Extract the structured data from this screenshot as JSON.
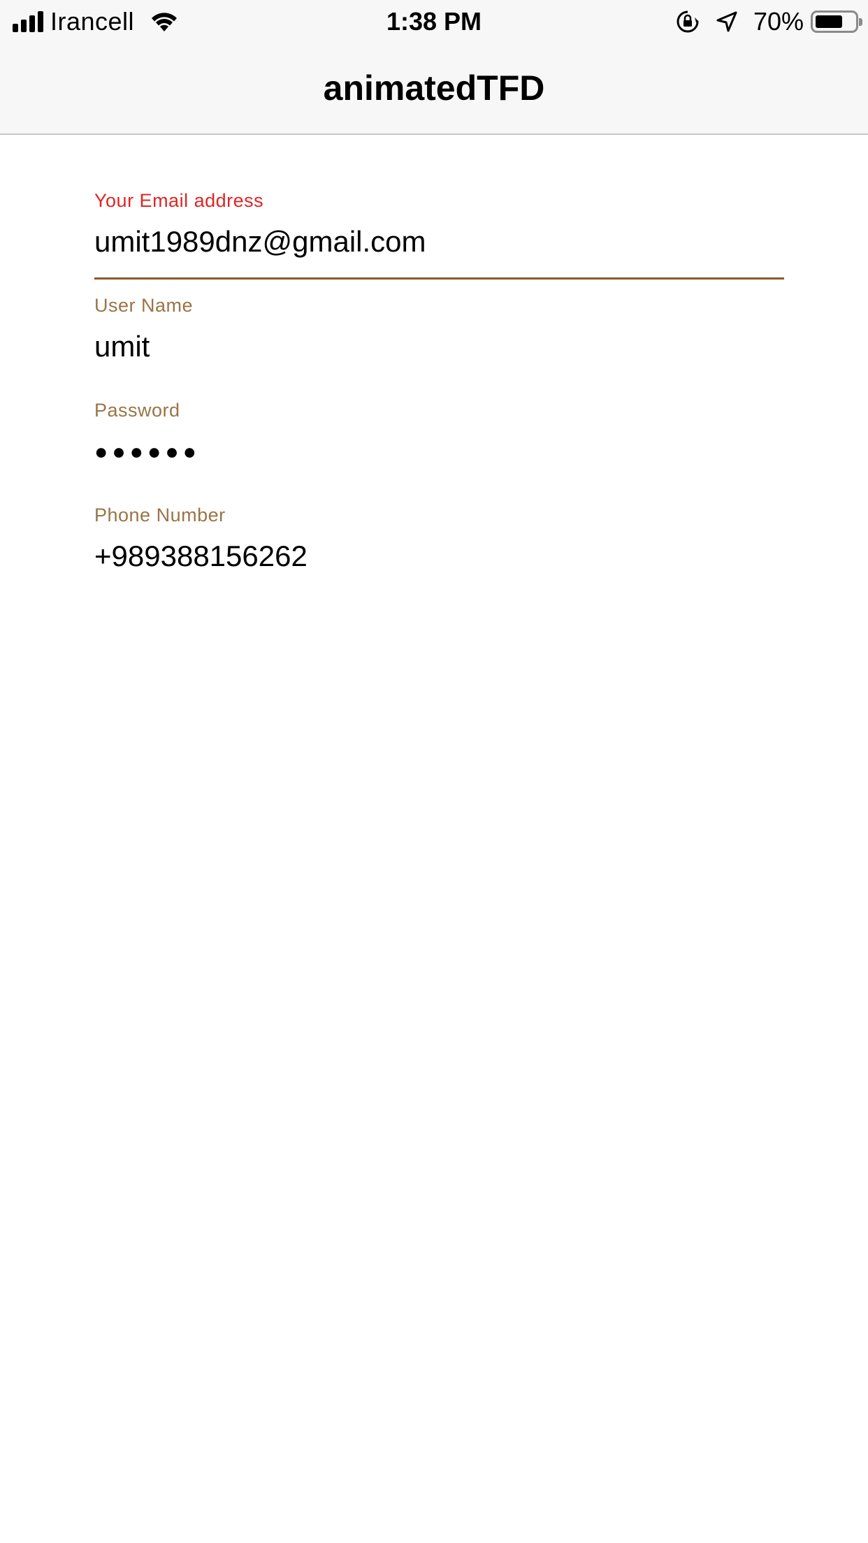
{
  "status_bar": {
    "carrier": "Irancell",
    "time": "1:38 PM",
    "battery_percent": "70%",
    "battery_level": 0.7
  },
  "nav": {
    "title": "animatedTFD"
  },
  "form": {
    "email": {
      "label": "Your Email address",
      "value": "umit1989dnz@gmail.com"
    },
    "username": {
      "label": "User Name",
      "value": "umit"
    },
    "password": {
      "label": "Password",
      "value": "●●●●●●"
    },
    "phone": {
      "label": "Phone Number",
      "value": "+989388156262"
    }
  },
  "colors": {
    "active_label": "#e02424",
    "inactive_label": "#9a7447",
    "underline": "#8b5a2b"
  }
}
